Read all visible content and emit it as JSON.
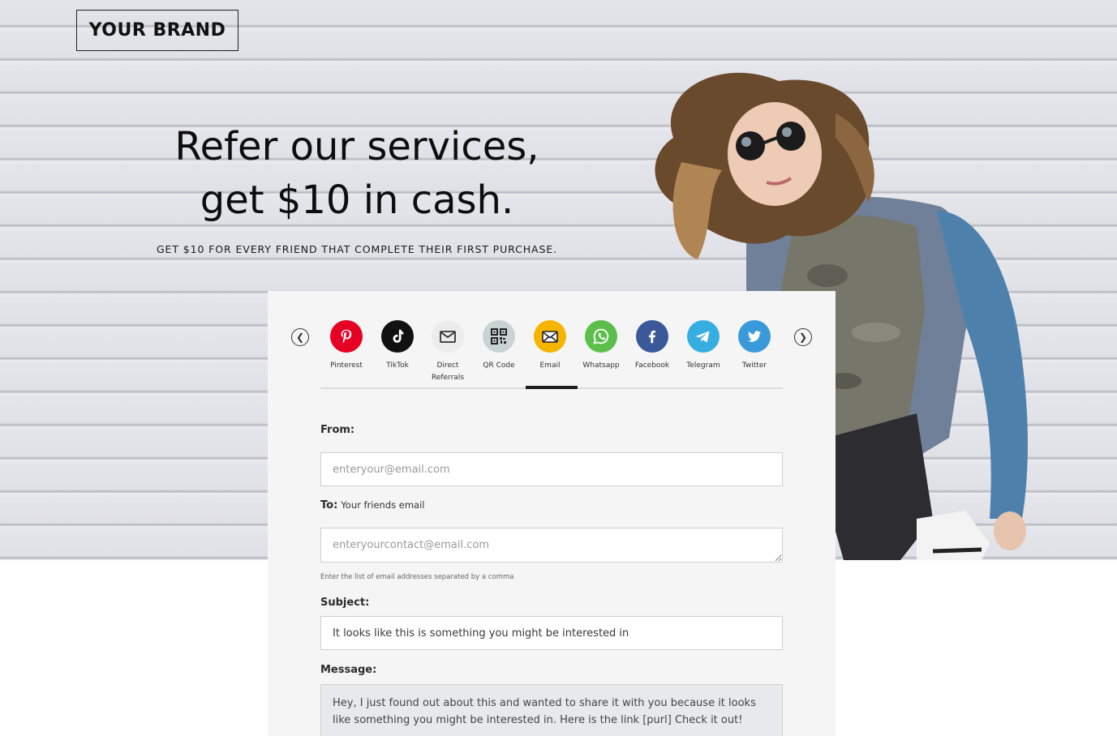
{
  "brand": {
    "logo_text": "YOUR BRAND"
  },
  "hero": {
    "headline_line1": "Refer our services,",
    "headline_line2": "get $10 in cash.",
    "subheadline": "GET $10 FOR EVERY FRIEND THAT COMPLETE THEIR FIRST PURCHASE."
  },
  "carousel": {
    "prev_icon": "chevron-left-icon",
    "next_icon": "chevron-right-icon"
  },
  "share": {
    "active": "Email",
    "items": [
      {
        "label": "Pinterest",
        "icon": "pinterest-icon",
        "color": "#e60023"
      },
      {
        "label": "TikTok",
        "icon": "tiktok-icon",
        "color": "#111111"
      },
      {
        "label": "Direct Referrals",
        "icon": "envelope-outline-icon",
        "color": "#ececec"
      },
      {
        "label": "QR Code",
        "icon": "qr-code-icon",
        "color": "#c9d3d4"
      },
      {
        "label": "Email",
        "icon": "email-icon",
        "color": "#f4b400"
      },
      {
        "label": "Whatsapp",
        "icon": "whatsapp-icon",
        "color": "#5cbf4b"
      },
      {
        "label": "Facebook",
        "icon": "facebook-icon",
        "color": "#3b5998"
      },
      {
        "label": "Telegram",
        "icon": "telegram-icon",
        "color": "#37aee2"
      },
      {
        "label": "Twitter",
        "icon": "twitter-icon",
        "color": "#3a9ad9"
      }
    ]
  },
  "form": {
    "from_label": "From:",
    "from_placeholder": "enteryour@email.com",
    "to_label": "To:",
    "to_sublabel": "Your friends email",
    "to_placeholder": "enteryourcontact@email.com",
    "to_hint": "Enter the list of email addresses separated by a comma",
    "subject_label": "Subject:",
    "subject_value": "It looks like this is something you might be interested in",
    "message_label": "Message:",
    "message_value": "Hey, I just found out about this and wanted to share it with you because it looks like something you might be interested in. Here is the link [purl] Check it out!"
  }
}
